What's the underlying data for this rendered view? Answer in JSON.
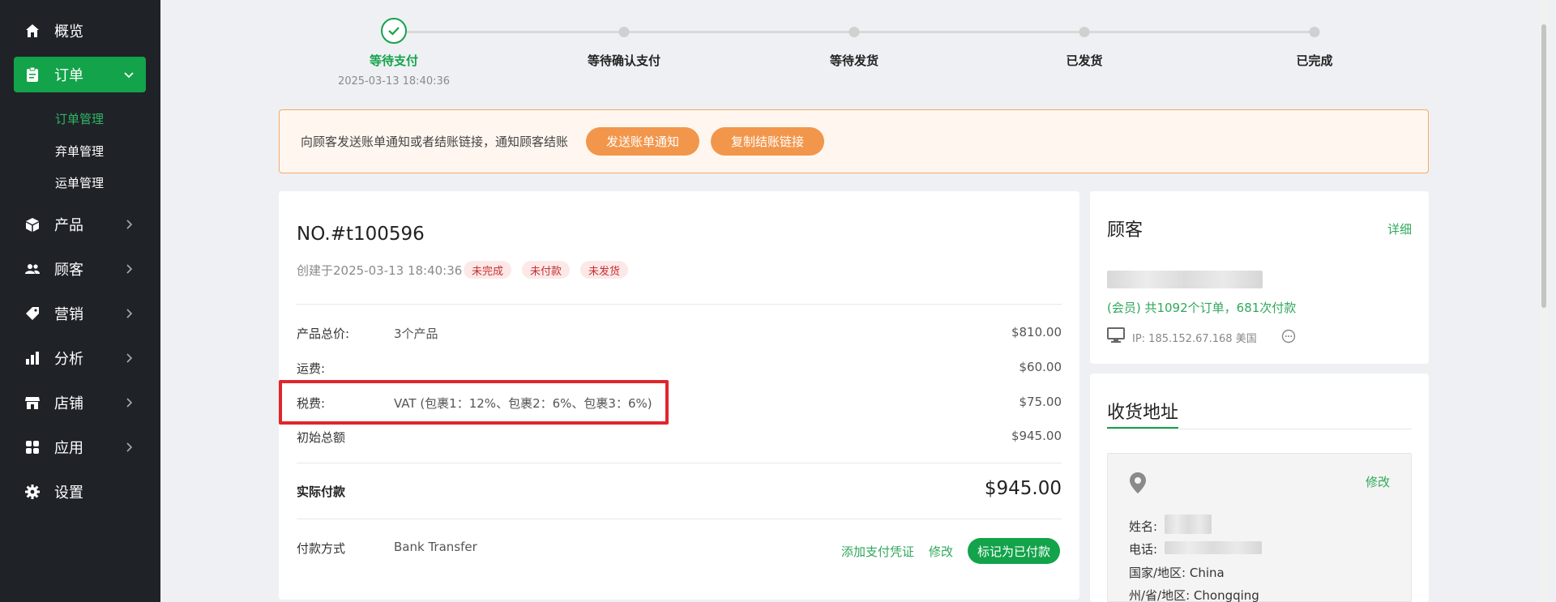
{
  "sidebar": {
    "items": [
      {
        "label": "概览",
        "icon": "home-icon"
      },
      {
        "label": "订单",
        "icon": "clipboard-icon"
      },
      {
        "label": "产品",
        "icon": "box-icon"
      },
      {
        "label": "顾客",
        "icon": "users-icon"
      },
      {
        "label": "营销",
        "icon": "tag-icon"
      },
      {
        "label": "分析",
        "icon": "bar-chart-icon"
      },
      {
        "label": "店铺",
        "icon": "store-icon"
      },
      {
        "label": "应用",
        "icon": "apps-icon"
      },
      {
        "label": "设置",
        "icon": "gear-icon"
      }
    ],
    "order_sub_items": [
      "订单管理",
      "弃单管理",
      "运单管理"
    ]
  },
  "steps": {
    "items": [
      "等待支付",
      "等待确认支付",
      "等待发货",
      "已发货",
      "已完成"
    ],
    "active_date": "2025-03-13 18:40:36"
  },
  "notice": {
    "text": "向顾客发送账单通知或者结账链接，通知顾客结账",
    "send_invoice_label": "发送账单通知",
    "copy_link_label": "复制结账链接"
  },
  "order": {
    "number": "NO.#t100596",
    "created": "创建于2025-03-13 18:40:36",
    "tags": [
      "未完成",
      "未付款",
      "未发货"
    ],
    "rows": {
      "subtotal_label": "产品总价:",
      "subtotal_value": "3个产品",
      "subtotal_amount": "$810.00",
      "shipping_label": "运费:",
      "shipping_amount": "$60.00",
      "tax_label": "税费:",
      "tax_value": "VAT (包裹1：12%、包裹2：6%、包裹3：6%)",
      "tax_amount": "$75.00",
      "initial_total_label": "初始总额",
      "initial_total_amount": "$945.00"
    },
    "paid_label": "实际付款",
    "paid_amount": "$945.00",
    "payment_method_label": "付款方式",
    "payment_method_value": "Bank Transfer",
    "add_proof_label": "添加支付凭证",
    "edit_label": "修改",
    "mark_paid_label": "标记为已付款"
  },
  "customer": {
    "title": "顾客",
    "detail_label": "详细",
    "stats": "(会员) 共1092个订单，681次付款",
    "ip": "IP: 185.152.67.168 美国"
  },
  "address": {
    "title": "收货地址",
    "edit_label": "修改",
    "name_label": "姓名:",
    "phone_label": "电话:",
    "country": "国家/地区: China",
    "state": "州/省/地区: Chongqing"
  },
  "colors": {
    "brand_green": "#13a34a",
    "orange": "#f2964b",
    "highlight_red": "#e0262b",
    "sidebar_bg": "#1f2328"
  }
}
